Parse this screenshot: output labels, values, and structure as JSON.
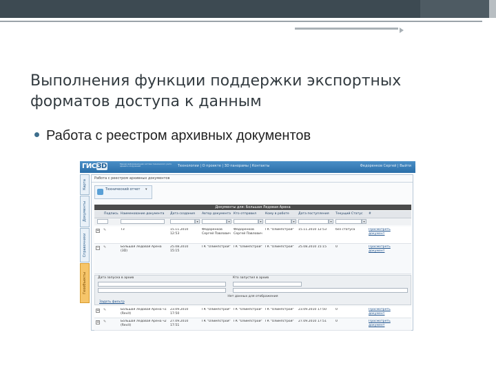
{
  "slide": {
    "title": "Выполнения функции поддержки экспортных форматов доступа к данным",
    "bullet": "Работа с реестром архивных документов"
  },
  "colors": {
    "header_blue": "#2a6ea8",
    "slide_dark_bar": "#3d4a52",
    "active_tab": "#f6c56a",
    "link": "#1a4f8a"
  },
  "app": {
    "logo_text": "ГИС",
    "logo_badge": "3D",
    "logo_subtitle": "Единая информационная система технического учета зданий и сооружений",
    "nav": "Технологии | О проекте | 3D панорамы | Контакты",
    "user": "Федоренков Сергей | Выйти",
    "side_tabs": [
      "Карта",
      "Документы",
      "Справочники",
      "Геообъекты"
    ],
    "breadcrumb": "Работа с реестром архивных документов",
    "type_selector": "Технический отчет",
    "table_title": "Документы для: Большая Ледовая Арена",
    "columns": [
      "Подпись",
      "Наименование документа",
      "Дата создания",
      "Автор документа",
      "Кто отправил",
      "Кому в работе",
      "Дата поступления",
      "Текущий Статус",
      "#"
    ],
    "rows": [
      {
        "name": "ТЗ",
        "created": "15.11.2010 12:53",
        "author": "Федоренков Сергей Павлович",
        "sender": "Федоренков Сергей Павлович",
        "receiver": "ГК \"Олимпстрой\"",
        "received": "15.11.2010 12:53",
        "status": "без статуса",
        "action": "Просмотреть документ"
      },
      {
        "name": "Большая Ледовая Арена (3D)",
        "created": "25.08.2010 15:15",
        "author": "ГК \"Олимпстрой\"",
        "sender": "ГК \"Олимпстрой\"",
        "receiver": "ГК \"Олимпстрой\"",
        "received": "25.08.2010 15:15",
        "status": "0",
        "action": "Просмотреть документ"
      }
    ],
    "subpanel": {
      "label_left": "Дата запуска в архив",
      "label_right": "Кто запустил в архив",
      "empty": "Нет данных для отображения",
      "add_link": "Задать фильтр"
    },
    "rows2": [
      {
        "name": "Большая Ледовая Арена ч1 (Revit)",
        "created": "23.09.2010 17:50",
        "author": "ГК \"Олимпстрой\"",
        "sender": "ГК \"Олимпстрой\"",
        "receiver": "ГК \"Олимпстрой\"",
        "received": "23.09.2010 17:50",
        "status": "0",
        "action": "Просмотреть документ"
      },
      {
        "name": "Большая Ледовая Арена ч2 (Revit)",
        "created": "27.09.2010 17:51",
        "author": "ГК \"Олимпстрой\"",
        "sender": "ГК \"Олимпстрой\"",
        "receiver": "ГК \"Олимпстрой\"",
        "received": "27.09.2010 17:51",
        "status": "0",
        "action": "Просмотреть документ"
      }
    ]
  }
}
